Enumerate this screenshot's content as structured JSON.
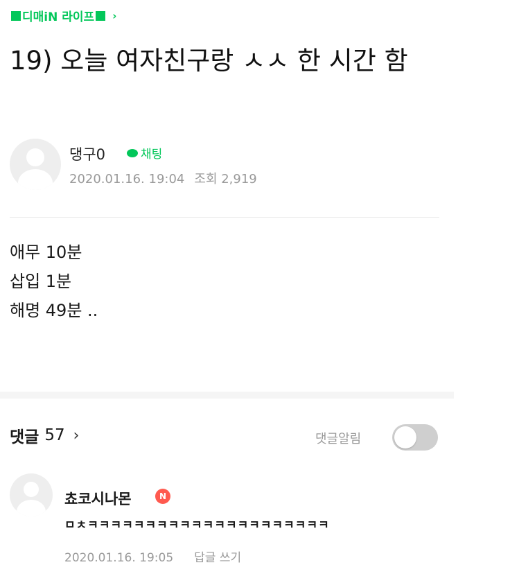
{
  "header": {
    "cafe_name": "디매iN 라이프",
    "title": "19) 오늘 여자친구랑 ㅅㅅ 한 시간 함"
  },
  "author": {
    "name": "댕구0",
    "chat_label": "채팅",
    "date": "2020.01.16. 19:04",
    "views": "조회 2,919"
  },
  "post": {
    "lines": [
      "애무 10분",
      "삽입 1분",
      "해명 49분 .."
    ]
  },
  "comments_section": {
    "label": "댓글",
    "count": "57",
    "notify_label": "댓글알림",
    "notify_on": false
  },
  "comment": {
    "author": "쵸코시나몬",
    "badge": "N",
    "text": "ㅁㅊㅋㅋㅋㅋㅋㅋㅋㅋㅋㅋㅋㅋㅋㅋㅋㅋㅋㅋㅋㅋㅋ",
    "date": "2020.01.16. 19:05",
    "reply_label": "답글 쓰기"
  },
  "icons": {
    "cafe_chevron": "chevron-right-icon",
    "chat": "chat-bubble-icon",
    "comments_chevron": "chevron-right-icon",
    "avatar": "default-avatar-icon",
    "new_badge": "new-badge-icon"
  },
  "colors": {
    "brand_green": "#03c75a",
    "new_badge_red": "#ff5a4f",
    "meta_gray": "#9a9a9a"
  }
}
